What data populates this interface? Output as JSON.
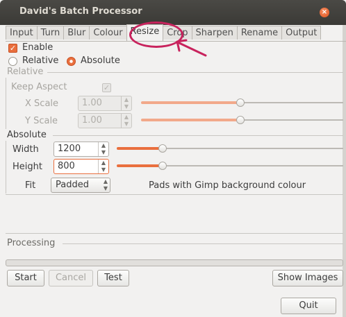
{
  "window": {
    "title": "David's Batch Processor",
    "close_glyph": "×"
  },
  "tabs": [
    "Input",
    "Turn",
    "Blur",
    "Colour",
    "Resize",
    "Crop",
    "Sharpen",
    "Rename",
    "Output"
  ],
  "active_tab": "Resize",
  "resize": {
    "enable_label": "Enable",
    "enable_checked": true,
    "mode_relative_label": "Relative",
    "mode_absolute_label": "Absolute",
    "mode_selected": "Absolute",
    "relative": {
      "frame_label": "Relative",
      "keep_aspect_label": "Keep Aspect",
      "keep_aspect_checked": true,
      "xscale_label": "X Scale",
      "xscale_value": "1.00",
      "yscale_label": "Y Scale",
      "yscale_value": "1.00"
    },
    "absolute": {
      "frame_label": "Absolute",
      "width_label": "Width",
      "width_value": "1200",
      "height_label": "Height",
      "height_value": "800",
      "fit_label": "Fit",
      "fit_value": "Padded",
      "fit_description": "Pads with Gimp background colour"
    }
  },
  "processing": {
    "label": "Processing",
    "progress": 0
  },
  "buttons": {
    "start": "Start",
    "cancel": "Cancel",
    "test": "Test",
    "show_images": "Show Images",
    "quit": "Quit"
  },
  "colors": {
    "accent": "#e96f3e",
    "annotation": "#c8235d",
    "titlebar": "#3b3a36"
  }
}
